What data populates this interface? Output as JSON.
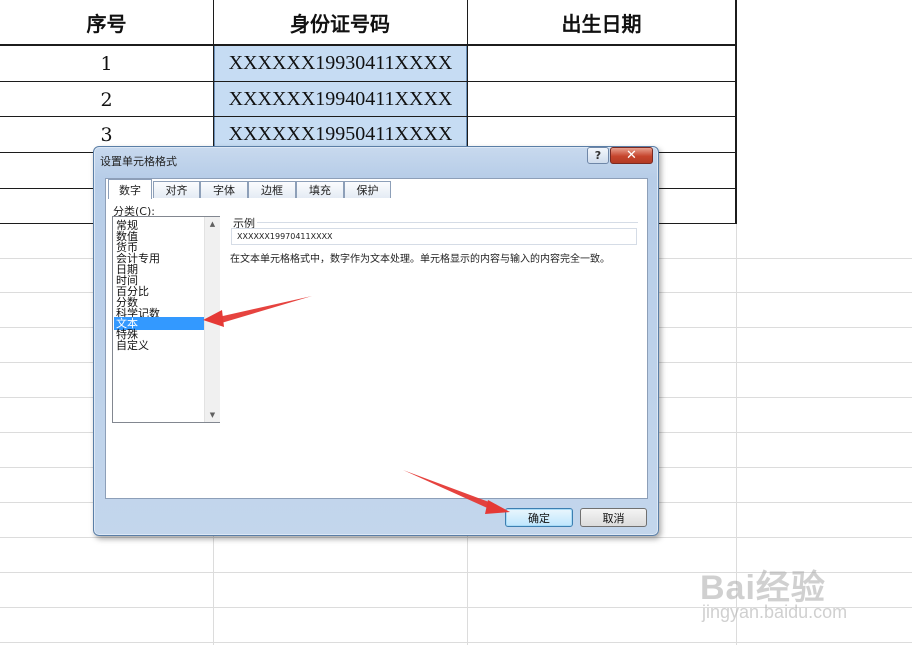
{
  "table": {
    "headers": [
      "序号",
      "身份证号码",
      "出生日期"
    ],
    "rows": [
      {
        "index": "1",
        "id": "XXXXXX19930411XXXX",
        "birth": ""
      },
      {
        "index": "2",
        "id": "XXXXXX19940411XXXX",
        "birth": ""
      },
      {
        "index": "3",
        "id": "XXXXXX19950411XXXX",
        "birth": ""
      }
    ],
    "selection_color": "#c6dcf3"
  },
  "dialog": {
    "title": "设置单元格格式",
    "help_label": "?",
    "close_label": "✕",
    "tabs": [
      "数字",
      "对齐",
      "字体",
      "边框",
      "填充",
      "保护"
    ],
    "active_tab": "数字",
    "category_label": "分类(C):",
    "categories": [
      "常规",
      "数值",
      "货币",
      "会计专用",
      "日期",
      "时间",
      "百分比",
      "分数",
      "科学记数",
      "文本",
      "特殊",
      "自定义"
    ],
    "selected_category": "文本",
    "sample_label": "示例",
    "sample_value": "XXXXXX19970411XXXX",
    "description": "在文本单元格格式中，数字作为文本处理。单元格显示的内容与输入的内容完全一致。",
    "ok_label": "确定",
    "cancel_label": "取消",
    "scroll_up_icon": "▲",
    "scroll_down_icon": "▼"
  },
  "watermark": {
    "logo": "Bai经验",
    "url": "jingyan.baidu.com"
  },
  "colors": {
    "annotation_arrow": "#e53935",
    "selected_category": "#3399ff",
    "close_button": "#c6452d"
  }
}
